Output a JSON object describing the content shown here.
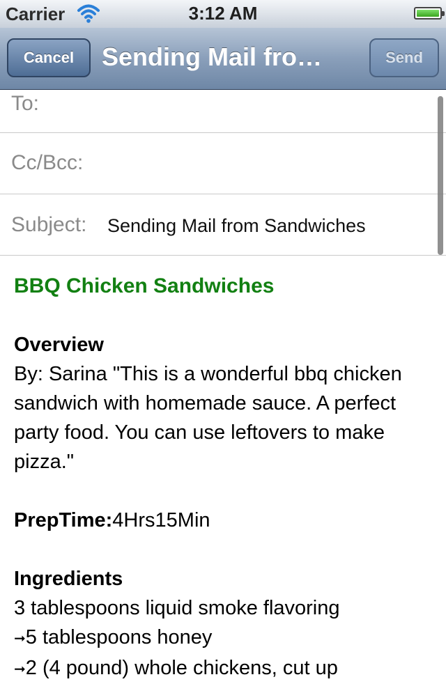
{
  "status_bar": {
    "carrier": "Carrier",
    "time": "3:12 AM",
    "battery_level": 1.0
  },
  "nav_bar": {
    "cancel_label": "Cancel",
    "title": "Sending Mail fro…",
    "send_label": "Send"
  },
  "fields": {
    "to_label": "To:",
    "to_value": "",
    "cc_label": "Cc/Bcc:",
    "cc_value": "",
    "subject_label": "Subject:",
    "subject_value": "Sending Mail from Sandwiches"
  },
  "body": {
    "recipe_title": "BBQ Chicken Sandwiches",
    "overview_heading": "Overview",
    "overview_text": "By: Sarina \"This is a wonderful bbq chicken sandwich with homemade sauce. A perfect party food. You can use leftovers to make pizza.\"",
    "prep_label": "PrepTime:",
    "prep_value": "4Hrs15Min",
    "ingredients_heading": "Ingredients",
    "ingredients": [
      "3 tablespoons liquid smoke flavoring",
      "5 tablespoons honey",
      "2 (4 pound) whole chickens, cut up"
    ],
    "bullet_icon": "arrow-bullet-icon"
  },
  "colors": {
    "recipe_title": "#128012",
    "nav_bar": "#7f95b1",
    "label_gray": "#8a8a8a"
  }
}
